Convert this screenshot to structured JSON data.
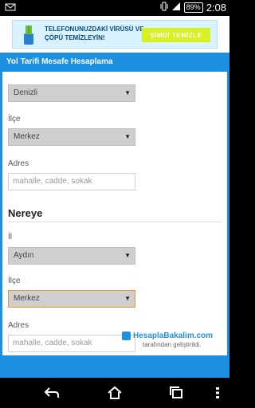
{
  "status_bar": {
    "battery": "89%",
    "time": "2:08"
  },
  "ad": {
    "text": "TELEFONUNUZDAKİ VİRÜSÜ VE ÇÖPÜ TEMİZLEYİN!",
    "button": "ŞİMDİ TEMİZLE"
  },
  "app": {
    "title": "Yol Tarifi Mesafe Hesaplama"
  },
  "from": {
    "city_value": "Denizli",
    "district_label": "İlçe",
    "district_value": "Merkez",
    "address_label": "Adres",
    "address_placeholder": "mahalle, cadde, sokak"
  },
  "to": {
    "section_title": "Nereye",
    "city_label": "İl",
    "city_value": "Aydın",
    "district_label": "İlçe",
    "district_value": "Merkez",
    "address_label": "Adres",
    "address_placeholder": "mahalle, cadde, sokak"
  },
  "brand": {
    "name": "HesaplaBakalim.com",
    "tagline": "tarafından geliştirildi."
  },
  "colors": {
    "accent": "#1e90e0",
    "ad_button": "#d6f020"
  }
}
